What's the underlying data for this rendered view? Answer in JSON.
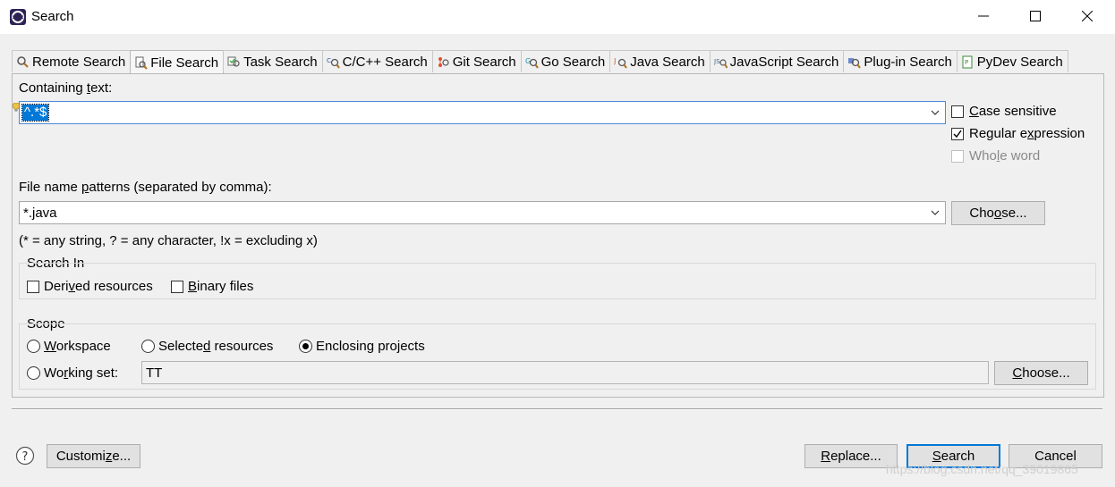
{
  "window": {
    "title": "Search",
    "minimize_icon": "minimize-icon",
    "maximize_icon": "maximize-icon",
    "close_icon": "close-icon"
  },
  "tabs": [
    {
      "label": "Remote Search",
      "icon": "remote-search-icon",
      "active": false
    },
    {
      "label": "File Search",
      "icon": "file-search-icon",
      "active": true
    },
    {
      "label": "Task Search",
      "icon": "task-search-icon",
      "active": false
    },
    {
      "label": "C/C++ Search",
      "icon": "cpp-search-icon",
      "active": false
    },
    {
      "label": "Git Search",
      "icon": "git-search-icon",
      "active": false
    },
    {
      "label": "Go Search",
      "icon": "go-search-icon",
      "active": false
    },
    {
      "label": "Java Search",
      "icon": "java-search-icon",
      "active": false
    },
    {
      "label": "JavaScript Search",
      "icon": "javascript-search-icon",
      "active": false
    },
    {
      "label": "Plug-in Search",
      "icon": "plugin-search-icon",
      "active": false
    },
    {
      "label": "PyDev Search",
      "icon": "pydev-search-icon",
      "active": false
    }
  ],
  "containing": {
    "label": "Containing text:",
    "label_pre": "Containing ",
    "label_key": "t",
    "label_post": "ext:",
    "value": "^.*$"
  },
  "options": {
    "case_sensitive": {
      "pre": "",
      "key": "C",
      "post": "ase sensitive",
      "checked": false
    },
    "regular_expression": {
      "pre": "Regular e",
      "key": "x",
      "post": "pression",
      "checked": true
    },
    "whole_word": {
      "pre": "Who",
      "key": "l",
      "post": "e word",
      "checked": false,
      "enabled": false
    }
  },
  "patterns": {
    "label_pre": "File name ",
    "label_key": "p",
    "label_post": "atterns (separated by comma):",
    "value": "*.java",
    "choose_pre": "Cho",
    "choose_key": "o",
    "choose_post": "se...",
    "hint": "(* = any string, ? = any character, !x = excluding x)"
  },
  "search_in": {
    "title": "Search In",
    "derived": {
      "pre": "Deri",
      "key": "v",
      "post": "ed resources",
      "checked": false
    },
    "binary": {
      "pre": "",
      "key": "B",
      "post": "inary files",
      "checked": false
    }
  },
  "scope": {
    "title": "Scope",
    "workspace": {
      "pre": "",
      "key": "W",
      "post": "orkspace",
      "selected": false
    },
    "selected_resources": {
      "pre": "Selecte",
      "key": "d",
      "post": " resources",
      "selected": false
    },
    "enclosing_projects": {
      "pre": "Enclosing projects",
      "key": "",
      "post": "",
      "selected": true
    },
    "working_set": {
      "pre": "Wo",
      "key": "r",
      "post": "king set:",
      "selected": false,
      "value": "TT"
    },
    "choose_pre": "",
    "choose_key": "C",
    "choose_post": "hoose..."
  },
  "footer": {
    "help_icon": "help-icon",
    "customize_pre": "Customi",
    "customize_key": "z",
    "customize_post": "e...",
    "replace_pre": "",
    "replace_key": "R",
    "replace_post": "eplace...",
    "search_pre": "",
    "search_key": "S",
    "search_post": "earch",
    "cancel": "Cancel"
  },
  "watermark": "https://blog.csdn.net/qq_39019865"
}
